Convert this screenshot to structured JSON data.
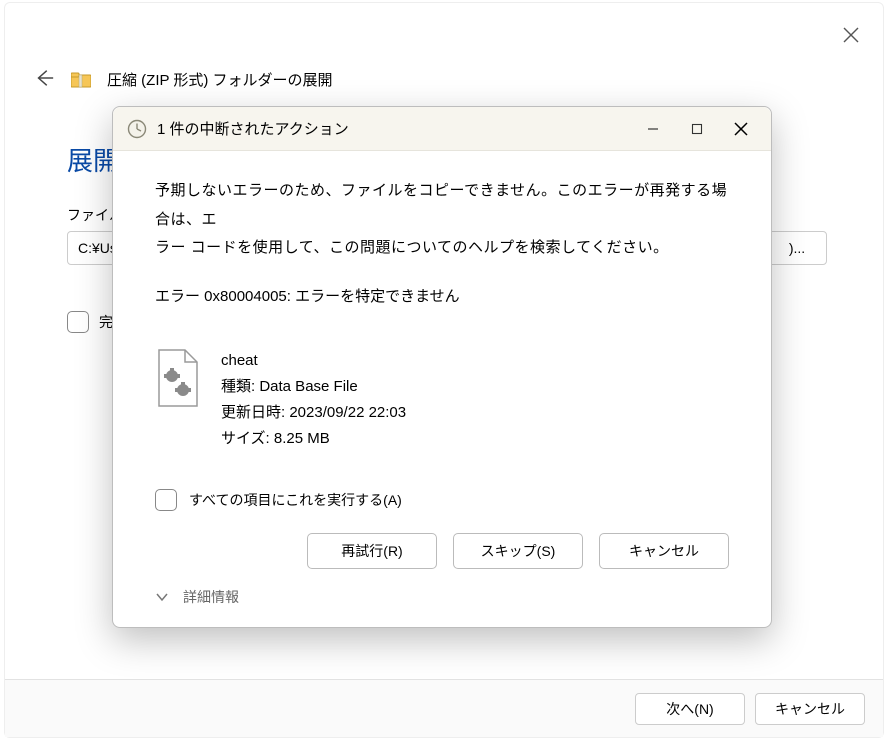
{
  "window": {
    "wizard_title": "圧縮 (ZIP 形式) フォルダーの展開",
    "section_title": "展開",
    "path_label": "ファイル",
    "path_value": "C:¥Us",
    "browse_label": ")...",
    "done_checkbox_label": "完",
    "next_btn": "次へ(N)",
    "cancel_btn": "キャンセル"
  },
  "dialog": {
    "title": "1 件の中断されたアクション",
    "error_line1": "予期しないエラーのため、ファイルをコピーできません。このエラーが再発する場合は、エ",
    "error_line2": "ラー コードを使用して、この問題についてのヘルプを検索してください。",
    "error_code": "エラー 0x80004005: エラーを特定できません",
    "file": {
      "name": "cheat",
      "type_label": "種類: Data Base File",
      "modified_label": "更新日時: 2023/09/22 22:03",
      "size_label": "サイズ: 8.25 MB"
    },
    "apply_all_label": "すべての項目にこれを実行する(A)",
    "retry_btn": "再試行(R)",
    "skip_btn": "スキップ(S)",
    "cancel_btn": "キャンセル",
    "details_label": "詳細情報"
  }
}
